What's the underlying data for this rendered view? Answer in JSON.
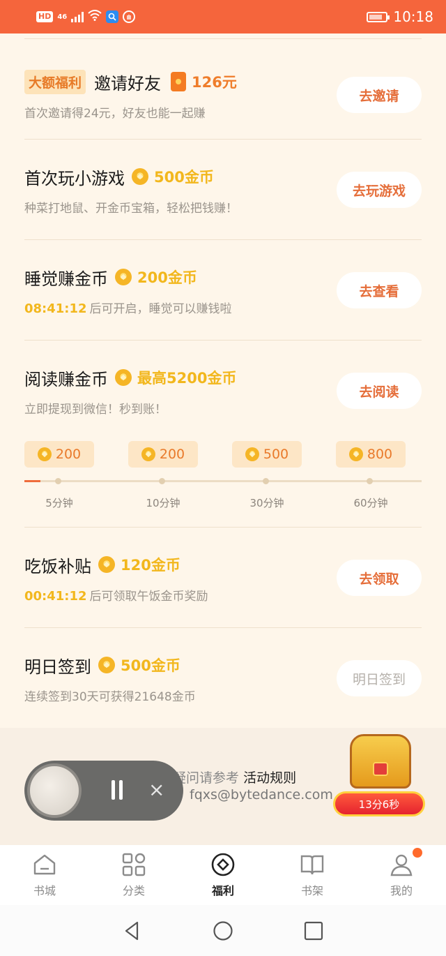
{
  "status_bar": {
    "hd": "HD",
    "network": "46",
    "time": "10:18"
  },
  "tasks": [
    {
      "tag": "大额福利",
      "title": "邀请好友",
      "reward_icon": "red-envelope-icon",
      "reward": "126元",
      "subtitle": "首次邀请得24元，好友也能一起赚",
      "button": "去邀请"
    },
    {
      "title": "首次玩小游戏",
      "reward_icon": "coin-icon",
      "reward": "500金币",
      "subtitle": "种菜打地鼠、开金币宝箱，轻松把钱赚！",
      "button": "去玩游戏"
    },
    {
      "title": "睡觉赚金币",
      "reward_icon": "coin-icon",
      "reward": "200金币",
      "countdown": "08:41:12",
      "subtitle": "后可开启，睡觉可以赚钱啦",
      "button": "去查看"
    },
    {
      "title": "阅读赚金币",
      "reward_icon": "coin-icon",
      "reward": "最高5200金币",
      "subtitle": "立即提现到微信！秒到账！",
      "button": "去阅读",
      "milestones": [
        {
          "coins": "200",
          "label": "5分钟"
        },
        {
          "coins": "200",
          "label": "10分钟"
        },
        {
          "coins": "500",
          "label": "30分钟"
        },
        {
          "coins": "800",
          "label": "60分钟"
        }
      ],
      "progress_fraction": 0.04
    },
    {
      "title": "吃饭补贴",
      "reward_icon": "coin-icon",
      "reward": "120金币",
      "countdown": "00:41:12",
      "subtitle": "后可领取午饭金币奖励",
      "button": "去领取"
    },
    {
      "title": "明日签到",
      "reward_icon": "coin-icon",
      "reward": "500金币",
      "subtitle": "连续签到30天可获得21648金币",
      "button": "明日签到"
    }
  ],
  "footer": {
    "rules_prefix": "疑问请参考",
    "rules_link": "活动规则",
    "email": "fqxs@bytedance.com"
  },
  "chest": {
    "timer": "13分6秒"
  },
  "bottom_nav": [
    {
      "label": "书城",
      "icon": "bookstore-icon"
    },
    {
      "label": "分类",
      "icon": "category-icon"
    },
    {
      "label": "福利",
      "icon": "welfare-icon",
      "active": true
    },
    {
      "label": "书架",
      "icon": "bookshelf-icon"
    },
    {
      "label": "我的",
      "icon": "profile-icon",
      "badge": true
    }
  ],
  "colors": {
    "status_bar": "#f5653c",
    "accent_orange": "#e56e3a",
    "coin_gold": "#f2b71d",
    "background": "#fef6ea"
  }
}
